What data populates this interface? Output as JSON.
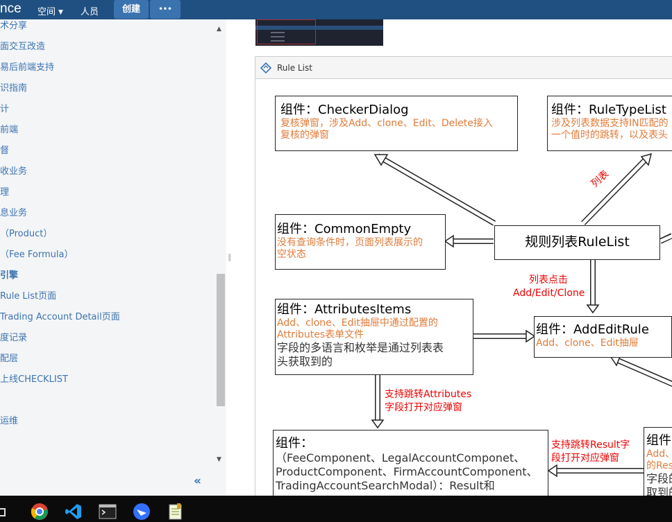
{
  "topbar": {
    "logo": "nce",
    "nav_space": "空间",
    "nav_people": "人员",
    "create_button": "创建",
    "more_button": "•••"
  },
  "sidebar": {
    "items": [
      {
        "label": "术分享"
      },
      {
        "label": "面交互改造"
      },
      {
        "label": "易后前端支持"
      },
      {
        "label": "识指南"
      },
      {
        "label": "计"
      },
      {
        "label": "前端"
      },
      {
        "label": "督"
      },
      {
        "label": "收业务"
      },
      {
        "label": "理"
      },
      {
        "label": "息业务"
      },
      {
        "label": "（Product）"
      },
      {
        "label": "（Fee Formula）"
      },
      {
        "label": "引擎"
      },
      {
        "label": "Rule List页面"
      },
      {
        "label": "Trading Account Detail页面"
      },
      {
        "label": "度记录"
      },
      {
        "label": "配层"
      },
      {
        "label": "上线CHECKLIST"
      },
      {
        "label": "运维"
      }
    ],
    "collapse_glyph": "«"
  },
  "page": {
    "panel_title": "Rule List"
  },
  "diagram": {
    "boxes": {
      "checker": {
        "title": "组件：CheckerDialog",
        "desc1": "复核弹窗，涉及Add、clone、Edit、Delete接入",
        "desc2": "复核的弹窗"
      },
      "ruletype": {
        "title": "组件：RuleTypeList",
        "desc1": "涉及列表数据支持IN匹配的",
        "desc2": "一个值时的跳转，以及表头"
      },
      "empty": {
        "title": "组件：CommonEmpty",
        "desc1": "没有查询条件时，页面列表展示的",
        "desc2": "空状态"
      },
      "rulelist": {
        "title": "规则列表RuleList"
      },
      "attrs": {
        "title": "组件：AttributesItems",
        "desc1": "Add、clone、Edit抽屉中通过配置的",
        "desc2": "Attributes表单文件",
        "gray1": "字段的多语言和枚举是通过列表表",
        "gray2": "头获取到的"
      },
      "addedit": {
        "title": "组件：AddEditRule",
        "desc1": "Add、clone、Edit抽屉"
      },
      "fee": {
        "title": "组件：",
        "line1": "（FeeComponent、LegalAccountComponet、",
        "line2": "ProductComponent、FirmAccountComponent、",
        "line3": "TradingAccountSearchModal）：Result和"
      },
      "result": {
        "title": "组件",
        "desc1": "Add、",
        "desc2": "的Res",
        "gray1": "字段的",
        "gray2": "取到的"
      }
    },
    "labels": {
      "list_label": "列表",
      "click_line1": "列表点击",
      "click_line2": "Add/Edit/Clone",
      "jump_attr1": "支持跳转Attributes",
      "jump_attr2": "字段打开对应弹窗",
      "jump_result1": "支持跳转Result字",
      "jump_result2": "段打开对应弹窗"
    }
  },
  "taskbar": {
    "icons": [
      "chrome-icon",
      "vscode-icon",
      "terminal-icon",
      "feishu-icon",
      "notepad-icon"
    ]
  }
}
